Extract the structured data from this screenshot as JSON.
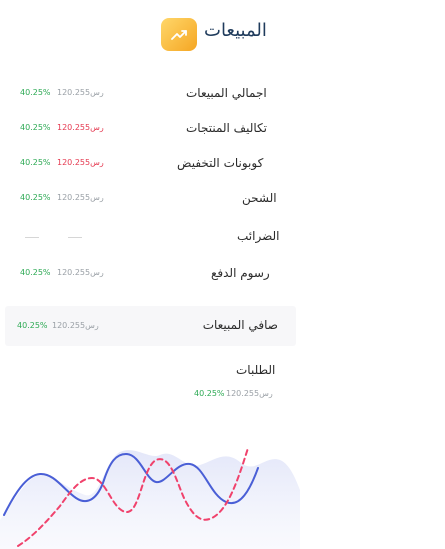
{
  "header": {
    "title": "المبيعات",
    "icon": "trending-up-icon",
    "icon_color": "#f5a623"
  },
  "rows": [
    {
      "label": "اجمالي المبيعات",
      "amount": "120.255رس",
      "amount_color": "gray",
      "pct": "40.25%"
    },
    {
      "label": "تكاليف المنتجات",
      "amount": "120.255رس",
      "amount_color": "red",
      "pct": "40.25%"
    },
    {
      "label": "كوبونات التخفيض",
      "amount": "120.255رس",
      "amount_color": "red",
      "pct": "40.25%"
    },
    {
      "label": "الشحن",
      "amount": "120.255رس",
      "amount_color": "gray",
      "pct": "40.25%"
    },
    {
      "label": "الضرائب"
    },
    {
      "label": "رسوم الدفع",
      "amount": "120.255رس",
      "amount_color": "gray",
      "pct": "40.25%"
    }
  ],
  "net": {
    "label": "صافي المبيعات",
    "amount": "120.255رس",
    "pct": "40.25%"
  },
  "orders": {
    "label": "الطلبات",
    "amount": "120.255رس",
    "pct": "40.25%"
  },
  "colors": {
    "accent": "#f5a623",
    "positive": "#2eaa55",
    "negative": "#e53950",
    "line_primary": "#4a5fd6",
    "line_secondary": "#f0426c"
  }
}
